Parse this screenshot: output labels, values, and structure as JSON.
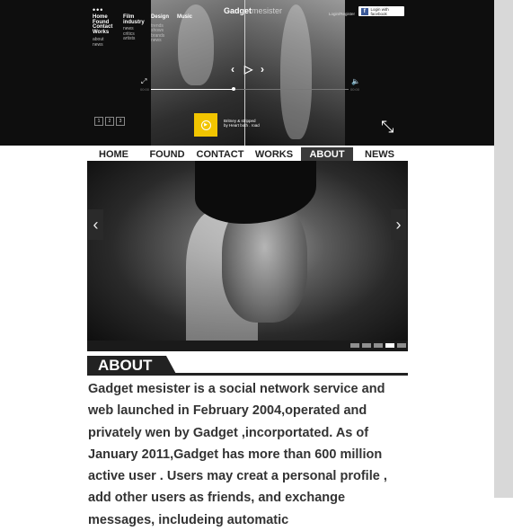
{
  "hero": {
    "menu_dots": "•••",
    "nav": [
      {
        "heading": "Home",
        "links": []
      },
      {
        "heading": "Found",
        "links": []
      },
      {
        "heading": "Contact",
        "links": []
      },
      {
        "heading": "Works",
        "links": [
          "about",
          "news"
        ]
      }
    ],
    "cols": [
      {
        "heading": "Film industry",
        "links": [
          "news",
          "critics",
          "artists"
        ]
      },
      {
        "heading": "Design",
        "links": [
          "trends",
          "shows",
          "brands",
          "news"
        ]
      },
      {
        "heading": "Music",
        "links": []
      }
    ],
    "logo_bold": "Gadget",
    "logo_rest": "mesister",
    "login_label": "Login/Register",
    "facebook_label": "Login with facebook",
    "player": {
      "progress": 0.42,
      "time_start": "00:00",
      "time_end": "00:00"
    },
    "pages": [
      "1",
      "2",
      "3"
    ],
    "song_title": "Britney & stripped by Heart both . road"
  },
  "topnav": {
    "items": [
      {
        "label": "HOME",
        "active": false
      },
      {
        "label": "FOUND",
        "active": false
      },
      {
        "label": "CONTACT",
        "active": false
      },
      {
        "label": "WORKS",
        "active": false
      },
      {
        "label": "ABOUT",
        "active": true
      },
      {
        "label": "NEWS",
        "active": false
      }
    ]
  },
  "slider": {
    "slide_count": 5,
    "active_index": 3
  },
  "about": {
    "title": "ABOUT",
    "paragraph": "Gadget mesister is a social network service and web launched in February 2004,operated and privately wen by Gadget ,incorportated. As of January 2011,Gadget has more than 600 million active user . Users may creat a personal profile , add other users as friends, and exchange messages, includeing automatic"
  },
  "colors": {
    "accent_yellow": "#f2c500",
    "dark": "#222222",
    "facebook": "#3b5998"
  }
}
